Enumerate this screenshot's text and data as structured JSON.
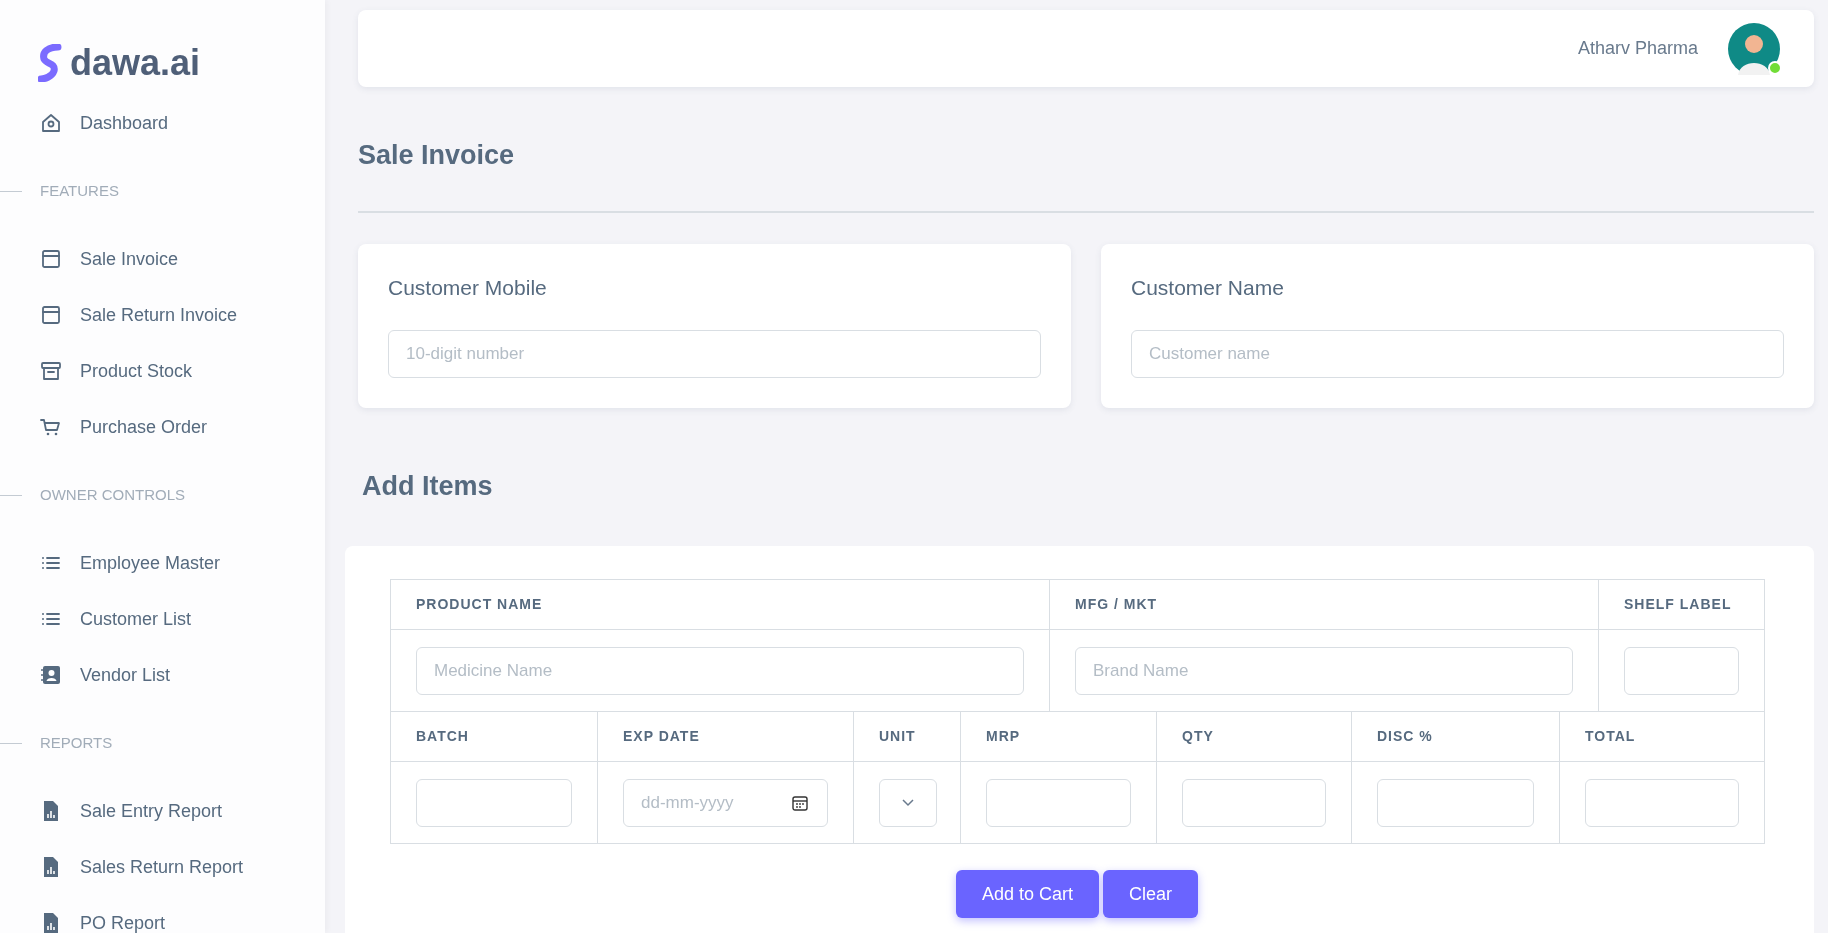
{
  "brand": {
    "name": "dawa.ai"
  },
  "sidebar": {
    "items": [
      {
        "label": "Dashboard",
        "selected": false
      }
    ],
    "sections": [
      {
        "heading": "FEATURES",
        "items": [
          {
            "label": "Sale Invoice",
            "selected": false
          },
          {
            "label": "Sale Return Invoice",
            "selected": false
          },
          {
            "label": "Product Stock",
            "selected": false
          },
          {
            "label": "Purchase Order",
            "selected": false
          }
        ]
      },
      {
        "heading": "OWNER CONTROLS",
        "items": [
          {
            "label": "Employee Master",
            "selected": false
          },
          {
            "label": "Customer List",
            "selected": false
          },
          {
            "label": "Vendor List",
            "selected": false
          }
        ]
      },
      {
        "heading": "REPORTS",
        "items": [
          {
            "label": "Sale Entry Report",
            "selected": false
          },
          {
            "label": "Sales Return Report",
            "selected": false
          },
          {
            "label": "PO Report",
            "selected": false
          }
        ]
      }
    ]
  },
  "header": {
    "user_name": "Atharv Pharma",
    "online": true
  },
  "page_title": "Sale Invoice",
  "customer_cards": [
    {
      "label": "Customer Mobile",
      "placeholder": "10-digit number"
    },
    {
      "label": "Customer Name",
      "placeholder": "Customer name"
    }
  ],
  "add_items": {
    "title": "Add Items",
    "tables": [
      {
        "columns": [
          "PRODUCT NAME",
          "MFG / MKT",
          "SHELF LABEL"
        ],
        "rows": [
          [
            {
              "kind": "text",
              "placeholder": "Medicine Name"
            },
            {
              "kind": "text",
              "placeholder": "Brand Name"
            },
            {
              "kind": "text"
            }
          ]
        ]
      },
      {
        "columns": [
          "BATCH",
          "EXP DATE",
          "UNIT",
          "MRP",
          "QTY",
          "DISC %",
          "TOTAL"
        ],
        "rows": [
          [
            {
              "kind": "text"
            },
            {
              "kind": "date",
              "placeholder": "dd-mm-yyyy"
            },
            {
              "kind": "select"
            },
            {
              "kind": "text"
            },
            {
              "kind": "text"
            },
            {
              "kind": "text"
            },
            {
              "kind": "text"
            }
          ]
        ]
      }
    ],
    "buttons": [
      "Add to Cart",
      "Clear"
    ]
  }
}
